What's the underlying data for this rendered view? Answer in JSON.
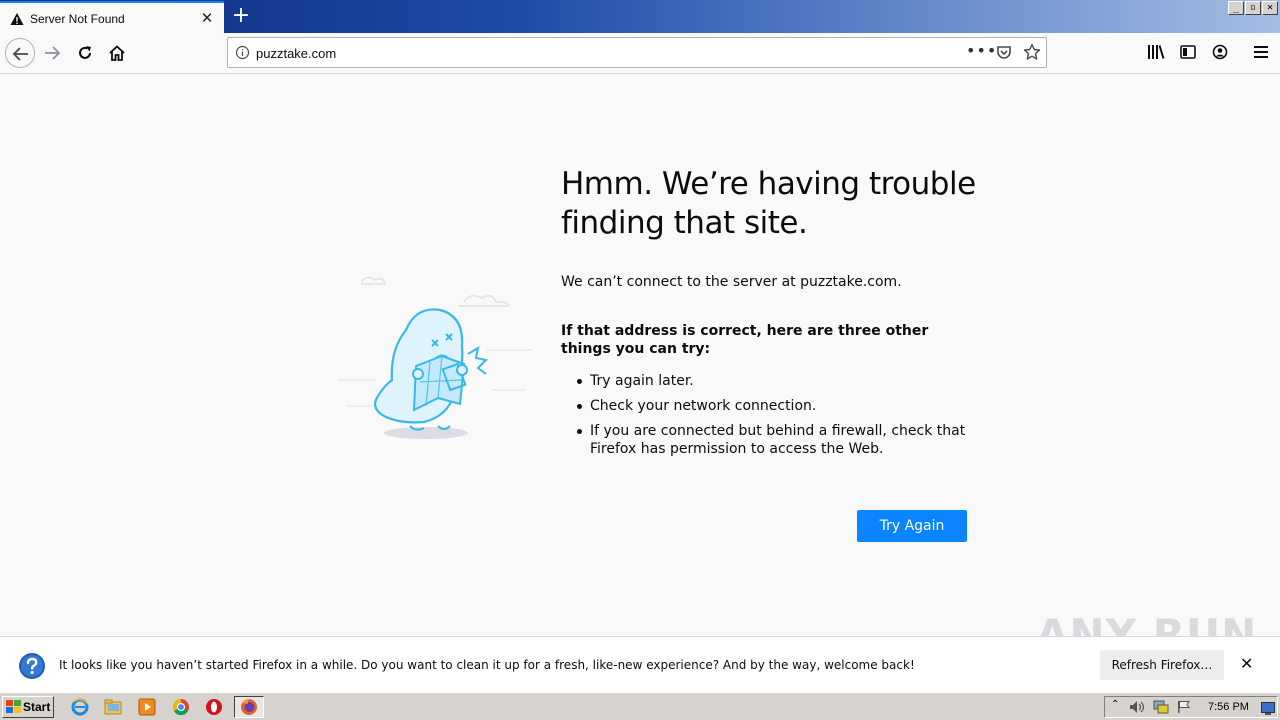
{
  "browser": {
    "tab_title": "Server Not Found",
    "new_tab_label": "+",
    "url": "puzztake.com",
    "page_actions_label": "•••",
    "window_buttons": [
      "_",
      "▫",
      "✕"
    ]
  },
  "error_page": {
    "title": "Hmm. We’re having trouble finding that site.",
    "description": "We can’t connect to the server at puzztake.com.",
    "suggestions_heading": "If that address is correct, here are three other things you can try:",
    "suggestions": [
      "Try again later.",
      "Check your network connection.",
      "If you are connected but behind a firewall, check that Firefox has permission to access the Web."
    ],
    "try_again_label": "Try Again"
  },
  "notification": {
    "text": "It looks like you haven’t started Firefox in a while. Do you want to clean it up for a fresh, like-new experience? And by the way, welcome back!",
    "refresh_label": "Refresh Firefox…",
    "close_label": "✕"
  },
  "watermark": "ANY RUN",
  "taskbar": {
    "start_label": "Start",
    "clock": "7:56 PM",
    "apps": [
      "internet-explorer-icon",
      "folder-icon",
      "media-player-icon",
      "chrome-icon",
      "opera-icon",
      "firefox-icon"
    ]
  },
  "colors": {
    "accent": "#0a84ff",
    "page_bg": "#f9f9fa",
    "illustration": "#39b8e8"
  }
}
